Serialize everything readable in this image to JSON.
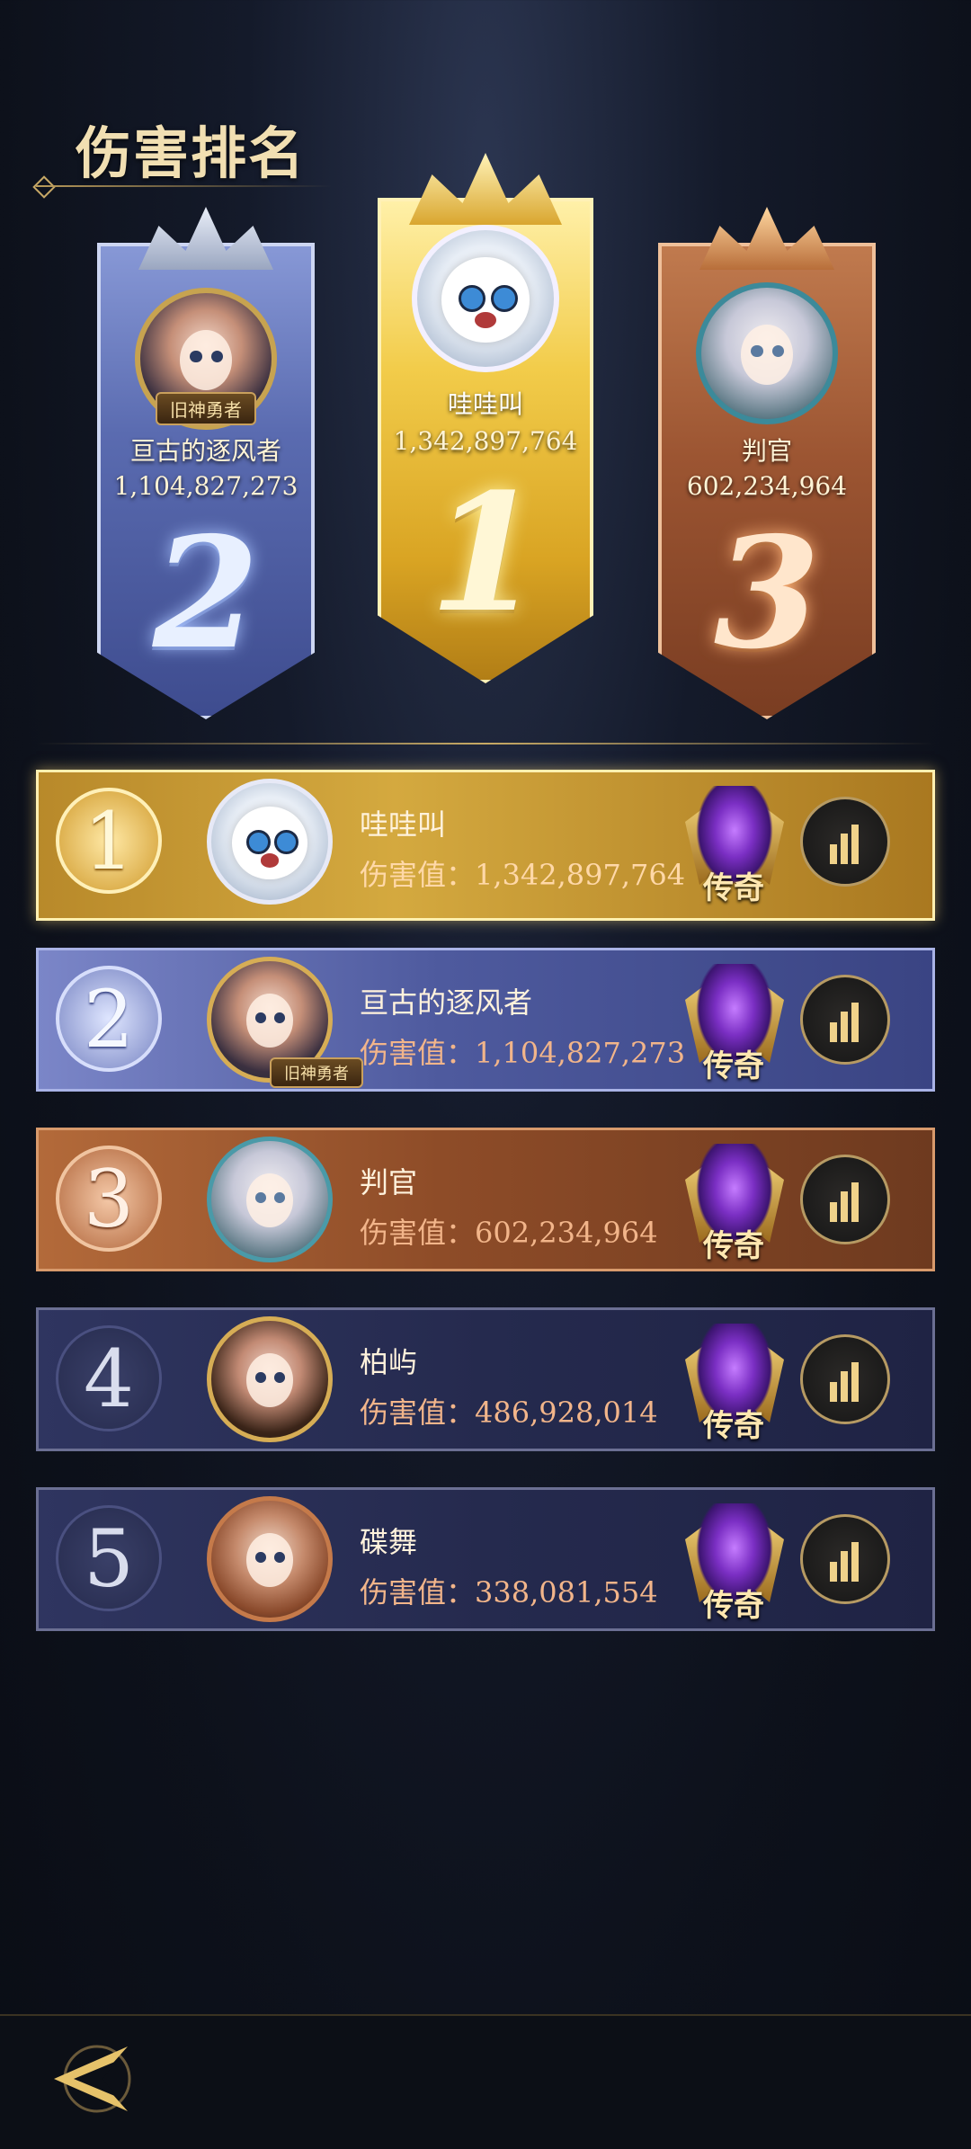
{
  "page": {
    "title": "伤害排名"
  },
  "podium": [
    {
      "rank_label": "2",
      "name": "亘古的逐风者",
      "score": "1,104,827,273",
      "tag": "旧神勇者"
    },
    {
      "rank_label": "1",
      "name": "哇哇叫",
      "score": "1,342,897,764"
    },
    {
      "rank_label": "3",
      "name": "判官",
      "score": "602,234,964"
    }
  ],
  "list": [
    {
      "rank": "1",
      "name": "哇哇叫",
      "damage": "伤害值：1,342,897,764",
      "tier": "传奇"
    },
    {
      "rank": "2",
      "name": "亘古的逐风者",
      "damage": "伤害值：1,104,827,273",
      "tier": "传奇",
      "tag": "旧神勇者"
    },
    {
      "rank": "3",
      "name": "判官",
      "damage": "伤害值：602,234,964",
      "tier": "传奇"
    },
    {
      "rank": "4",
      "name": "柏屿",
      "damage": "伤害值：486,928,014",
      "tier": "传奇"
    },
    {
      "rank": "5",
      "name": "碟舞",
      "damage": "伤害值：338,081,554",
      "tier": "传奇"
    }
  ],
  "icons": {
    "back": "back-arrow-icon",
    "stats": "bar-chart-icon",
    "tier": "legend-emblem-icon"
  },
  "colors": {
    "gold": "#e9b94a",
    "silver_blue": "#6f82c4",
    "bronze": "#a4582f",
    "dark_row": "#23284a"
  }
}
